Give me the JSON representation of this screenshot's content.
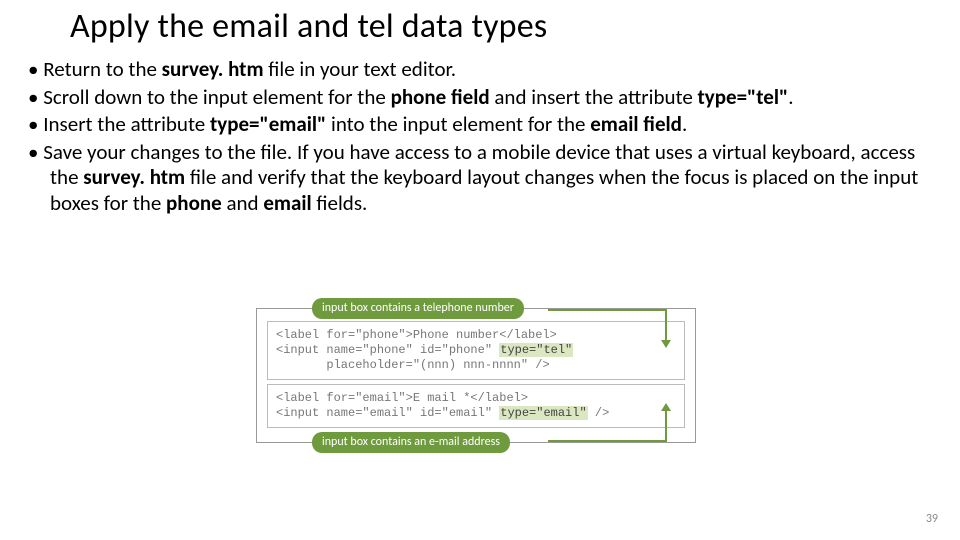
{
  "title": "Apply the email and tel data types",
  "bullets": [
    {
      "pre": "Return to the ",
      "b1": "survey. htm",
      "post1": " file in your text editor."
    },
    {
      "pre": "Scroll down to the input element for the ",
      "b1": "phone field",
      "mid": " and insert the attribute ",
      "b2": "type=\"tel\"",
      "post1": "."
    },
    {
      "pre": "Insert the attribute ",
      "b1": "type=\"email\"",
      "mid": " into the input element for the ",
      "b2": "email field",
      "post1": "."
    },
    {
      "pre": "Save your changes to the file. If you have access to a mobile device that uses a virtual keyboard, access the ",
      "b1": "survey. htm",
      "mid": " file and verify that the keyboard layout changes when the focus is placed on the input boxes for the ",
      "b2": "phone",
      "mid2": " and ",
      "b3": "email",
      "post1": " fields."
    }
  ],
  "callouts": {
    "top": "input box contains a telephone number",
    "bottom": "input box contains an e-mail address"
  },
  "code": {
    "line1a": "<label for=\"phone\">Phone number</label>",
    "line1b_pre": "<input name=\"phone\" id=\"phone\" ",
    "line1b_hl": "type=\"tel\"",
    "line1c": "       placeholder=\"(nnn) nnn-nnnn\" />",
    "line2a": "<label for=\"email\">E mail *</label>",
    "line2b_pre": "<input name=\"email\" id=\"email\" ",
    "line2b_hl": "type=\"email\"",
    "line2b_post": " />"
  },
  "page_number": "39"
}
